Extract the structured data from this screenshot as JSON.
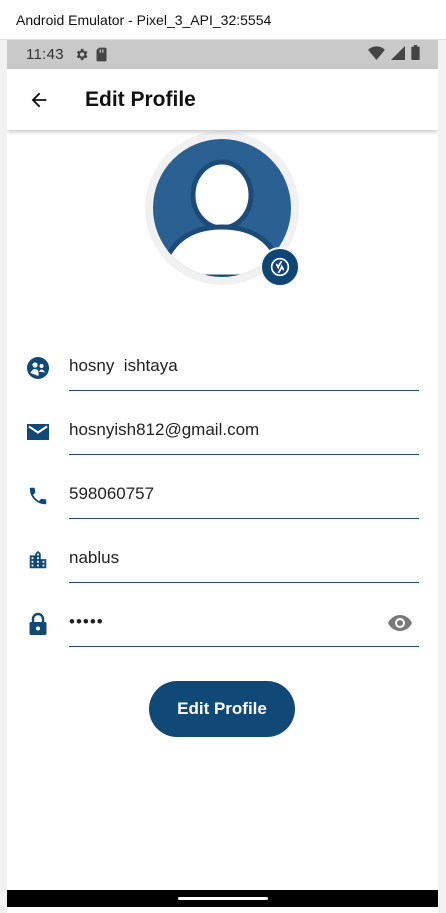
{
  "window": {
    "title": "Android Emulator - Pixel_3_API_32:5554"
  },
  "statusbar": {
    "time": "11:43",
    "icons": [
      "settings-icon",
      "sd-card-icon",
      "wifi-icon",
      "signal-icon",
      "battery-icon"
    ]
  },
  "appbar": {
    "title": "Edit Profile",
    "back_icon": "arrow-back-icon"
  },
  "avatar": {
    "camera_icon": "camera-icon"
  },
  "form": {
    "name": {
      "value": "hosny  ishtaya",
      "icon": "person-icon"
    },
    "email": {
      "value": "hosnyish812@gmail.com",
      "icon": "email-icon"
    },
    "phone": {
      "value": "598060757",
      "icon": "phone-icon"
    },
    "city": {
      "value": "nablus",
      "icon": "city-icon"
    },
    "password": {
      "value": "•••••",
      "icon": "lock-icon",
      "toggle_icon": "eye-icon"
    }
  },
  "submit": {
    "label": "Edit Profile"
  },
  "colors": {
    "primary": "#104975",
    "avatar_bg": "#2b6192",
    "underline": "#1e4b73",
    "statusbar": "#c9c9c9"
  }
}
